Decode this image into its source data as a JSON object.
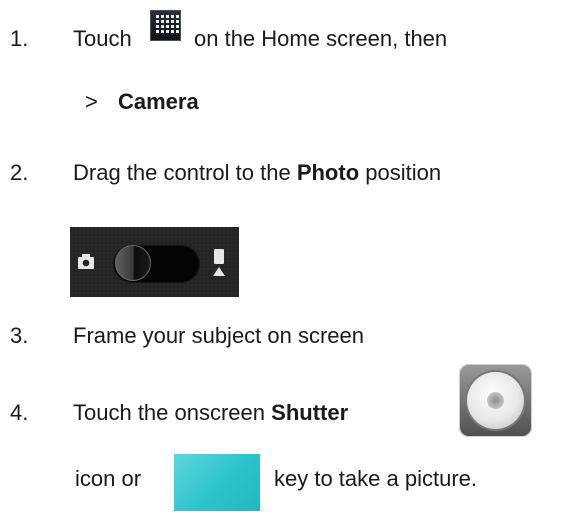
{
  "steps": [
    {
      "number": "1.",
      "text_before_icon": "Touch",
      "icon": "apps-grid-icon",
      "text_after_icon": "on the Home screen, then",
      "sub_arrow": ">",
      "sub_label": "Camera"
    },
    {
      "number": "2.",
      "text_before_bold": "Drag the control to the",
      "bold": "Photo",
      "text_after_bold": "position",
      "control_icons": [
        "camera-icon",
        "toggle-switch",
        "video-camera-icon"
      ]
    },
    {
      "number": "3.",
      "text": "Frame your subject on screen"
    },
    {
      "number": "4.",
      "text_before_bold": "Touch the onscreen",
      "bold": "Shutter",
      "icon": "shutter-icon",
      "line2_before": "icon or",
      "key_icon": "camera-key-icon",
      "line2_after": "key to take a picture."
    }
  ],
  "colors": {
    "key_accent": "#2cc3cc",
    "text": "#1a1a1a"
  }
}
